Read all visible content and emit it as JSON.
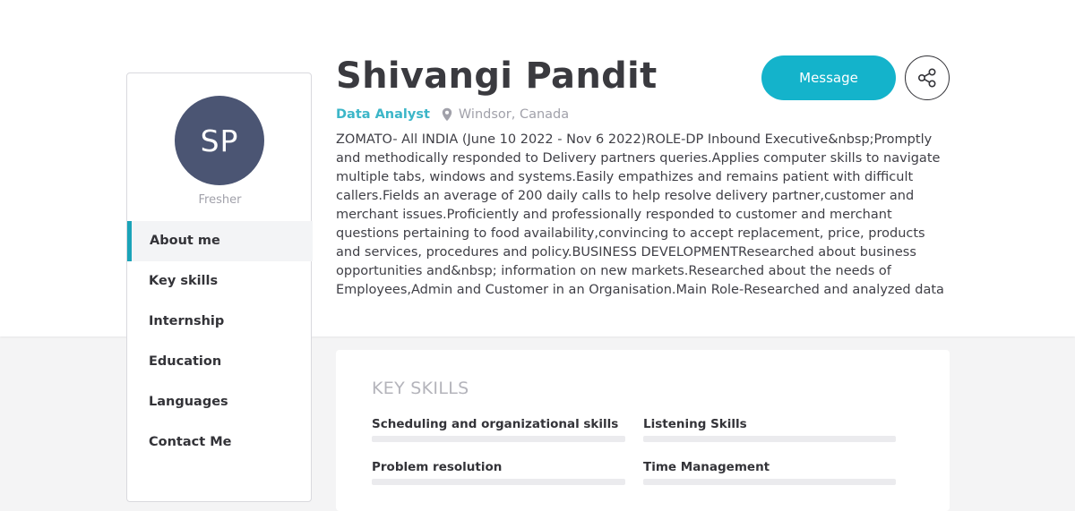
{
  "profile": {
    "initials": "SP",
    "status": "Fresher",
    "name": "Shivangi Pandit",
    "job_title": "Data Analyst",
    "location": "Windsor, Canada",
    "about": "ZOMATO- All INDIA (June 10 2022 - Nov 6 2022)ROLE-DP Inbound Executive&nbsp;Promptly and methodically responded to Delivery partners queries.Applies computer skills to navigate multiple tabs, windows and systems.Easily empathizes and remains patient with difficult callers.Fields an average of 200 daily calls to help resolve delivery partner,customer and merchant issues.Proficiently and professionally responded to customer and merchant questions pertaining to food availability,convincing to accept replacement, price, products and services, procedures and policy.BUSINESS DEVELOPMENTResearched about business opportunities and&nbsp; information on new markets.Researched about the needs of Employees,Admin and Customer in an Organisation.Main Role-Researched and analyzed data"
  },
  "actions": {
    "message_label": "Message"
  },
  "icons": {
    "share": "share-icon",
    "location": "map-pin-icon"
  },
  "nav": {
    "items": [
      {
        "label": "About me"
      },
      {
        "label": "Key skills"
      },
      {
        "label": "Internship"
      },
      {
        "label": "Education"
      },
      {
        "label": "Languages"
      },
      {
        "label": "Contact Me"
      }
    ]
  },
  "skills": {
    "heading": "KEY SKILLS",
    "items": [
      {
        "name": "Scheduling and organizational skills"
      },
      {
        "name": "Listening Skills"
      },
      {
        "name": "Problem resolution"
      },
      {
        "name": "Time Management"
      }
    ]
  },
  "colors": {
    "accent": "#14b3cb",
    "avatar": "#4b5573",
    "page_background": "#f4f4f5"
  }
}
